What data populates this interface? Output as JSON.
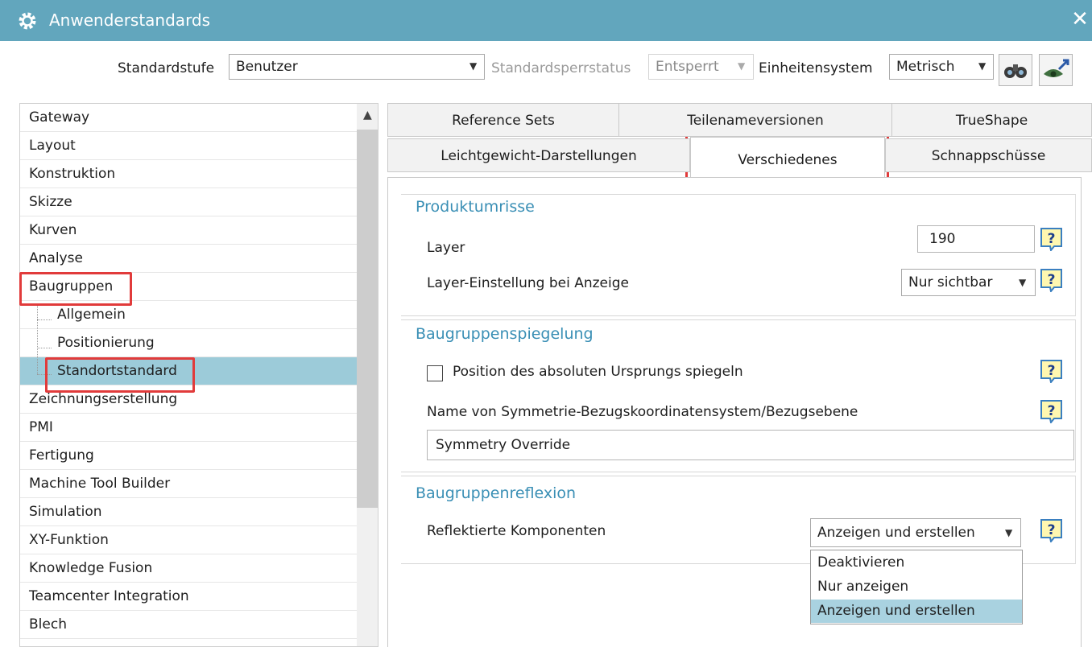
{
  "window": {
    "title": "Anwenderstandards",
    "close_glyph": "✕"
  },
  "toolbar": {
    "standard_level_label": "Standardstufe",
    "standard_level_value": "Benutzer",
    "lock_status_label": "Standardsperrstatus",
    "lock_status_value": "Entsperrt",
    "units_label": "Einheitensystem",
    "units_value": "Metrisch",
    "icons": [
      "binoculars-icon",
      "eye-arrow-icon"
    ]
  },
  "tree": {
    "items": [
      {
        "label": "Gateway"
      },
      {
        "label": "Layout"
      },
      {
        "label": "Konstruktion"
      },
      {
        "label": "Skizze"
      },
      {
        "label": "Kurven"
      },
      {
        "label": "Analyse"
      },
      {
        "label": "Baugruppen"
      },
      {
        "label": "Allgemein"
      },
      {
        "label": "Positionierung"
      },
      {
        "label": "Standortstandard"
      },
      {
        "label": "Zeichnungserstellung"
      },
      {
        "label": "PMI"
      },
      {
        "label": "Fertigung"
      },
      {
        "label": "Machine Tool Builder"
      },
      {
        "label": "Simulation"
      },
      {
        "label": "XY-Funktion"
      },
      {
        "label": "Knowledge Fusion"
      },
      {
        "label": "Teamcenter Integration"
      },
      {
        "label": "Blech"
      }
    ],
    "selected": "Standortstandard"
  },
  "tabs": {
    "row1": [
      "Reference Sets",
      "Teilenameversionen",
      "TrueShape"
    ],
    "row2": [
      "Leichtgewicht-Darstellungen",
      "Verschiedenes",
      "Schnappschüsse"
    ],
    "active": "Verschiedenes"
  },
  "groups": {
    "produktumrisse": {
      "title": "Produktumrisse",
      "layer_label": "Layer",
      "layer_value": "190",
      "layer_setting_label": "Layer-Einstellung bei Anzeige",
      "layer_setting_value": "Nur sichtbar"
    },
    "spiegelung": {
      "title": "Baugruppenspiegelung",
      "checkbox_label": "Position des absoluten Ursprungs spiegeln",
      "checkbox_checked": false,
      "name_label": "Name von Symmetrie-Bezugskoordinatensystem/Bezugsebene",
      "name_value": "Symmetry Override"
    },
    "reflexion": {
      "title": "Baugruppenreflexion",
      "components_label": "Reflektierte Komponenten",
      "components_value": "Anzeigen und erstellen",
      "options": [
        "Deaktivieren",
        "Nur anzeigen",
        "Anzeigen und erstellen"
      ],
      "selected_option": "Anzeigen und erstellen"
    }
  },
  "help_glyph": "?",
  "colors": {
    "titlebar": "#62a6bd",
    "accent_text": "#3a8fb5",
    "selection": "#9ccbd9",
    "highlight_box": "#e13b3b"
  }
}
